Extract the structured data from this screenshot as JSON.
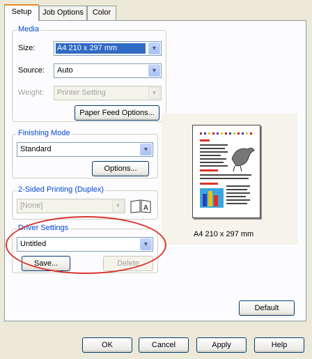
{
  "tabs": [
    {
      "label": "Setup",
      "active": true
    },
    {
      "label": "Job Options",
      "active": false
    },
    {
      "label": "Color",
      "active": false
    }
  ],
  "media": {
    "legend": "Media",
    "size_label": "Size:",
    "size_value": "A4 210 x 297 mm",
    "source_label": "Source:",
    "source_value": "Auto",
    "weight_label": "Weight:",
    "weight_value": "Printer Setting",
    "paper_feed_button": "Paper Feed Options..."
  },
  "finishing": {
    "legend": "Finishing Mode",
    "value": "Standard",
    "options_button": "Options..."
  },
  "duplex": {
    "legend": "2-Sided Printing (Duplex)",
    "value": "[None]"
  },
  "driver": {
    "legend": "Driver Settings",
    "value": "Untitled",
    "save_button": "Save...",
    "delete_button": "Delete"
  },
  "preview": {
    "caption": "A4 210 x 297 mm"
  },
  "default_button": "Default",
  "footer": {
    "ok": "OK",
    "cancel": "Cancel",
    "apply": "Apply",
    "help": "Help"
  },
  "colors": {
    "accent_red": "#d9342b",
    "selection_blue": "#316ac5",
    "group_title_blue": "#0046d5"
  }
}
